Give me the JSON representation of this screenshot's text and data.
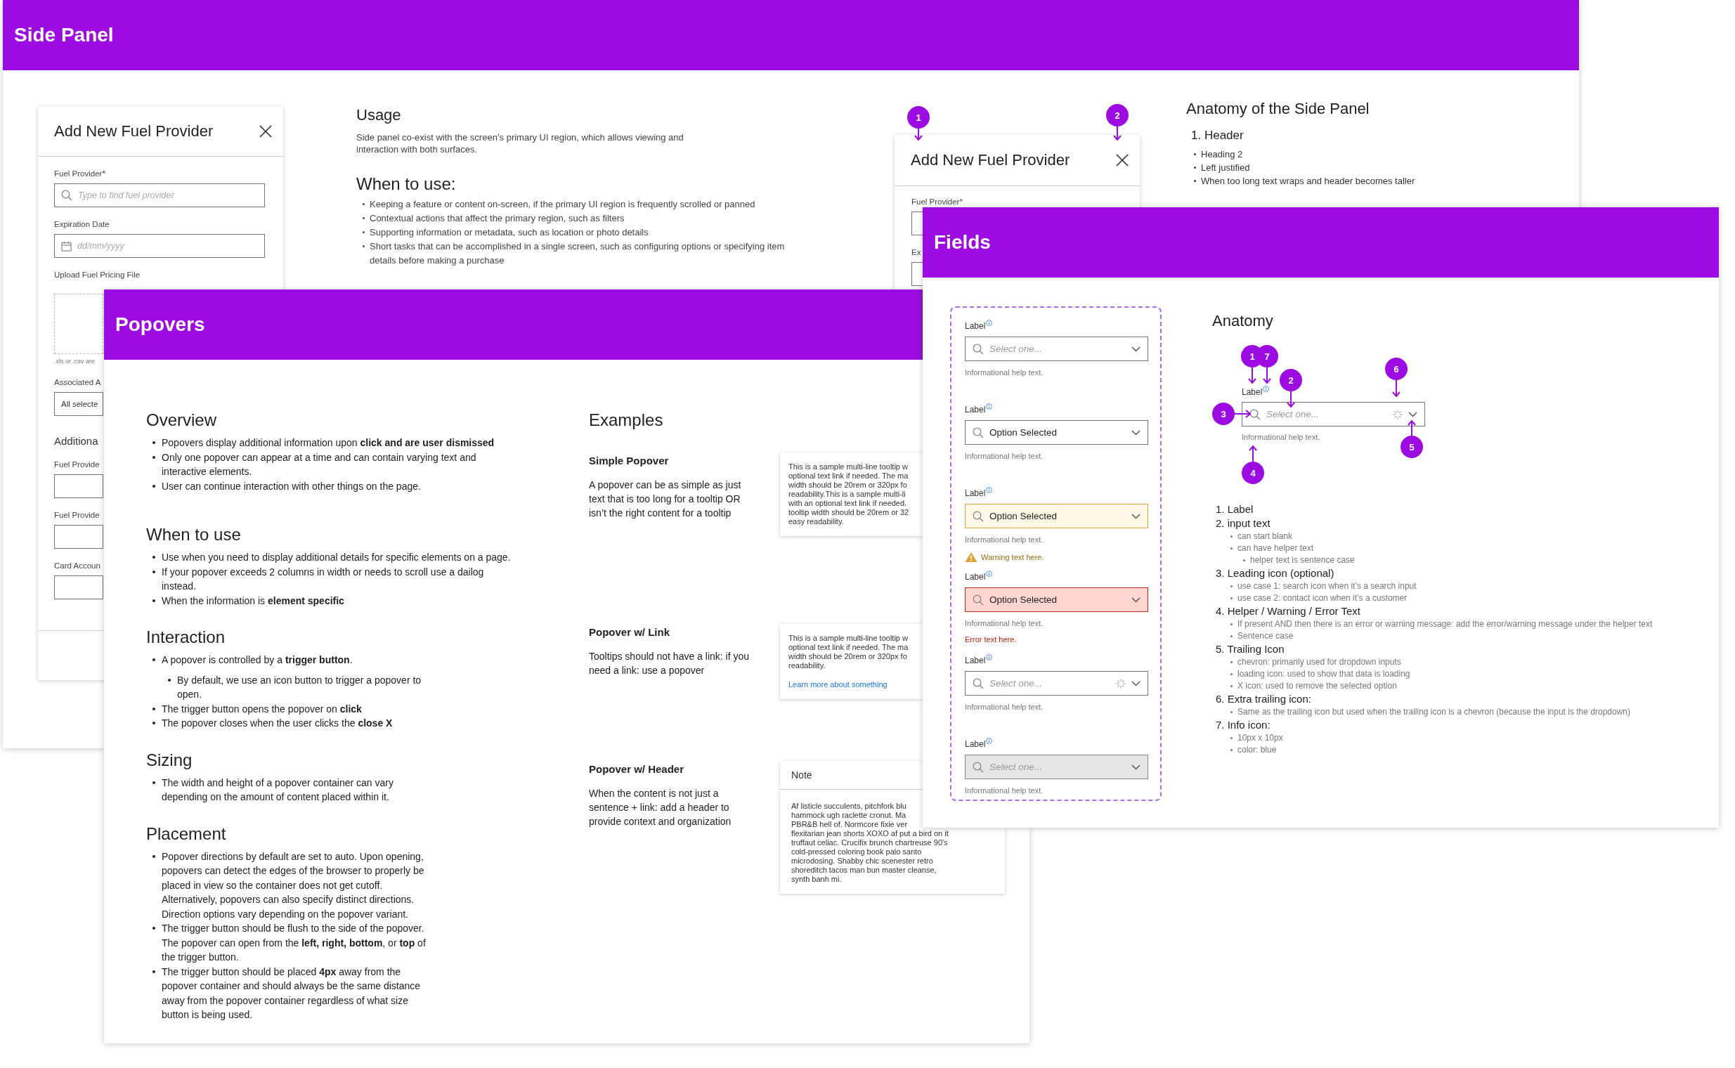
{
  "side_panel_page": {
    "title": "Side Panel",
    "example_panel": {
      "title": "Add New Fuel Provider",
      "fields": [
        {
          "kind": "search",
          "label": "Fuel Provider*",
          "placeholder": "Type to find fuel provider"
        },
        {
          "kind": "date",
          "label": "Expiration Date",
          "placeholder": "dd/mm/yyyy"
        },
        {
          "kind": "upload",
          "label": "Upload Fuel Pricing File",
          "hint": ".xls or .csv are"
        },
        {
          "kind": "select",
          "label": "Associated A",
          "value": "All selecte"
        },
        {
          "kind": "heading",
          "text": "Additiona"
        },
        {
          "kind": "text",
          "label": "Fuel Provide"
        },
        {
          "kind": "text",
          "label": "Fuel Provide"
        },
        {
          "kind": "text",
          "label": "Card Accoun"
        }
      ]
    },
    "usage": {
      "heading": "Usage",
      "text": "Side panel co-exist with the screen’s primary UI region, which allows viewing and interaction with both surfaces.",
      "when_heading": "When to use:",
      "bullets": [
        {
          "text": "Keeping a feature or content on-screen, if the primary UI region is frequently scrolled or panned"
        },
        {
          "text": "Contextual actions that affect the primary region, such as filters"
        },
        {
          "text": "Supporting information or metadata, such as location or photo details"
        },
        {
          "text": "Short tasks that can be accomplished in a single screen, such as configuring options or specifying item details before making a purchase"
        }
      ]
    },
    "anatomy_panel": {
      "title": "Add New Fuel Provider",
      "markers": [
        "1",
        "2"
      ],
      "fields": [
        {
          "kind": "text",
          "label": "Fuel Provider*"
        },
        {
          "kind": "text",
          "label": "Ex"
        }
      ]
    },
    "anatomy": {
      "heading": "Anatomy of the Side Panel",
      "items": [
        {
          "title": "1. Header",
          "bullets": [
            {
              "text": "Heading 2"
            },
            {
              "text": "Left justified"
            },
            {
              "text": "When too long text wraps and header becomes taller"
            }
          ]
        }
      ]
    }
  },
  "popovers_page": {
    "title": "Popovers",
    "sections": [
      {
        "heading": "Overview",
        "bullets": [
          {
            "text": "Popovers display additional information upon **click and are user dismissed**"
          },
          {
            "text": "Only one popover can appear at a time and can contain varying text and interactive elements."
          },
          {
            "text": "User can continue interaction with other things on the page."
          }
        ]
      },
      {
        "heading": "When to use",
        "bullets": [
          {
            "text": "Use when you need to display additional details for specific elements on a page."
          },
          {
            "text": "If your popover exceeds 2 columns in width or needs to scroll use a dailog instead."
          },
          {
            "text": "When the information is **element specific**"
          }
        ]
      },
      {
        "heading": "Interaction",
        "bullets": [
          {
            "text": "A popover is controlled by a **trigger button**.",
            "children": [
              {
                "text": "By default, we use an icon button to trigger a popover to open."
              }
            ]
          },
          {
            "text": "The trigger button opens the popover on **click**"
          },
          {
            "text": "The popover closes when the user clicks the **close X**"
          }
        ]
      },
      {
        "heading": "Sizing",
        "bullets": [
          {
            "text": "The width and height of a popover container can vary depending on the amount of content placed within it."
          }
        ]
      },
      {
        "heading": "Placement",
        "bullets": [
          {
            "text": "Popover directions by default are set to auto. Upon opening, popovers can detect the edges of the browser to properly be placed in view so the container does not get cutoff. Alternatively, popovers can also specify distinct directions. Direction options vary depending on the popover variant."
          },
          {
            "text": "The trigger button should be flush to the side of the popover. The popover can open from the **left, right, bottom**, or **top** of the trigger button."
          },
          {
            "text": "The trigger button should be placed **4px** away from the popover container and should always be the same distance away from the popover container regardless of what size button is being used."
          }
        ]
      }
    ],
    "examples": {
      "heading": "Examples",
      "items": [
        {
          "title": "Simple Popover",
          "text": "A popover can be as simple as just text that is too long for a tooltip OR isn’t the right content for a tooltip",
          "popover": {
            "kind": "plain",
            "text": "This is a sample multi-line tooltip w\noptional text link if needed. The ma\nwidth should be 20rem or 320px fo\nreadability.This is a sample multi-li\nwith an optional text link if needed.\ntooltip width should be 20rem or 32\neasy readability."
          }
        },
        {
          "title": "Popover w/ Link",
          "text": "Tooltips should not have a link: if you need a link: use a popover",
          "popover": {
            "kind": "link",
            "text": "This is a sample multi-line tooltip w\noptional text link if needed. The ma\nwidth should be 20rem or 320px fo\nreadability.",
            "link": "Learn more about something"
          }
        },
        {
          "title": "Popover w/ Header",
          "text": "When the content is not just a sentence + link: add a header to provide context and organization",
          "popover": {
            "kind": "header",
            "header": "Note",
            "text": "Af listicle succulents, pitchfork blu\nhammock ugh raclette cronut. Ma\nPBR&B hell of. Normcore fixie ver\nflexitarian jean shorts XOXO af put a bird on it\ntruffaut celiac. Crucifix brunch chartreuse 90's\ncold-pressed coloring book palo santo\nmicrodosing. Shabby chic scenester retro\nshoreditch tacos man bun master cleanse,\nsynth banh mi."
          }
        }
      ]
    }
  },
  "fields_page": {
    "title": "Fields",
    "examples": [
      {
        "label": "Label",
        "placeholder": "Select one...",
        "help": "Informational help text.",
        "warning": false,
        "error": false,
        "loading": false,
        "disabled": false
      },
      {
        "label": "Label",
        "value": "Option Selected",
        "help": "Informational help text.",
        "warning": false,
        "error": false,
        "loading": false,
        "disabled": false
      },
      {
        "label": "Label",
        "value": "Option Selected",
        "help": "Informational help text.",
        "warning": true,
        "error": false,
        "message": "Warning text here.",
        "loading": false,
        "disabled": false
      },
      {
        "label": "Label",
        "value": "Option Selected",
        "help": "Informational help text.",
        "warning": false,
        "error": true,
        "message": "Error text here.",
        "loading": false,
        "disabled": false
      },
      {
        "label": "Label",
        "placeholder": "Select one...",
        "help": "Informational help text.",
        "warning": false,
        "error": false,
        "loading": true,
        "disabled": false
      },
      {
        "label": "Label",
        "placeholder": "Select one...",
        "help": "Informational help text.",
        "warning": false,
        "error": false,
        "loading": false,
        "disabled": true
      }
    ],
    "anatomy": {
      "heading": "Anatomy",
      "diagram": {
        "label": "Label",
        "placeholder": "Select one...",
        "help": "Informational help text.",
        "loading": true,
        "markers": [
          "1",
          "7",
          "2",
          "6",
          "3",
          "5",
          "4"
        ]
      },
      "items": [
        {
          "title": "1. Label"
        },
        {
          "title": "2. input text",
          "bullets": [
            {
              "text": "can start blank"
            },
            {
              "text": "can have helper text",
              "children": [
                {
                  "text": "helper text is sentence case"
                }
              ]
            }
          ]
        },
        {
          "title": "3. Leading icon (optional)",
          "bullets": [
            {
              "text": "use case 1: search icon when it’s a search input"
            },
            {
              "text": "use case 2: contact icon when it’s a customer"
            }
          ]
        },
        {
          "title": "4. Helper / Warning / Error Text",
          "bullets": [
            {
              "text": "If present AND then there is an error or warning message: add the error/warning message under the helper text"
            },
            {
              "text": "Sentence case"
            }
          ]
        },
        {
          "title": "5. Trailing Icon",
          "bullets": [
            {
              "text": "chevron: primarily used for dropdown inputs"
            },
            {
              "text": "loading icon: used to show that data is loading"
            },
            {
              "text": "X icon: used to remove the selected option"
            }
          ]
        },
        {
          "title": "6. Extra trailing icon:",
          "bullets": [
            {
              "text": "Same as the trailing icon but used when the trailing icon is a chevron (because the input is the dropdown)"
            }
          ]
        },
        {
          "title": "7. Info icon:",
          "bullets": [
            {
              "text": "10px x 10px"
            },
            {
              "text": "color: blue"
            }
          ]
        }
      ]
    }
  }
}
